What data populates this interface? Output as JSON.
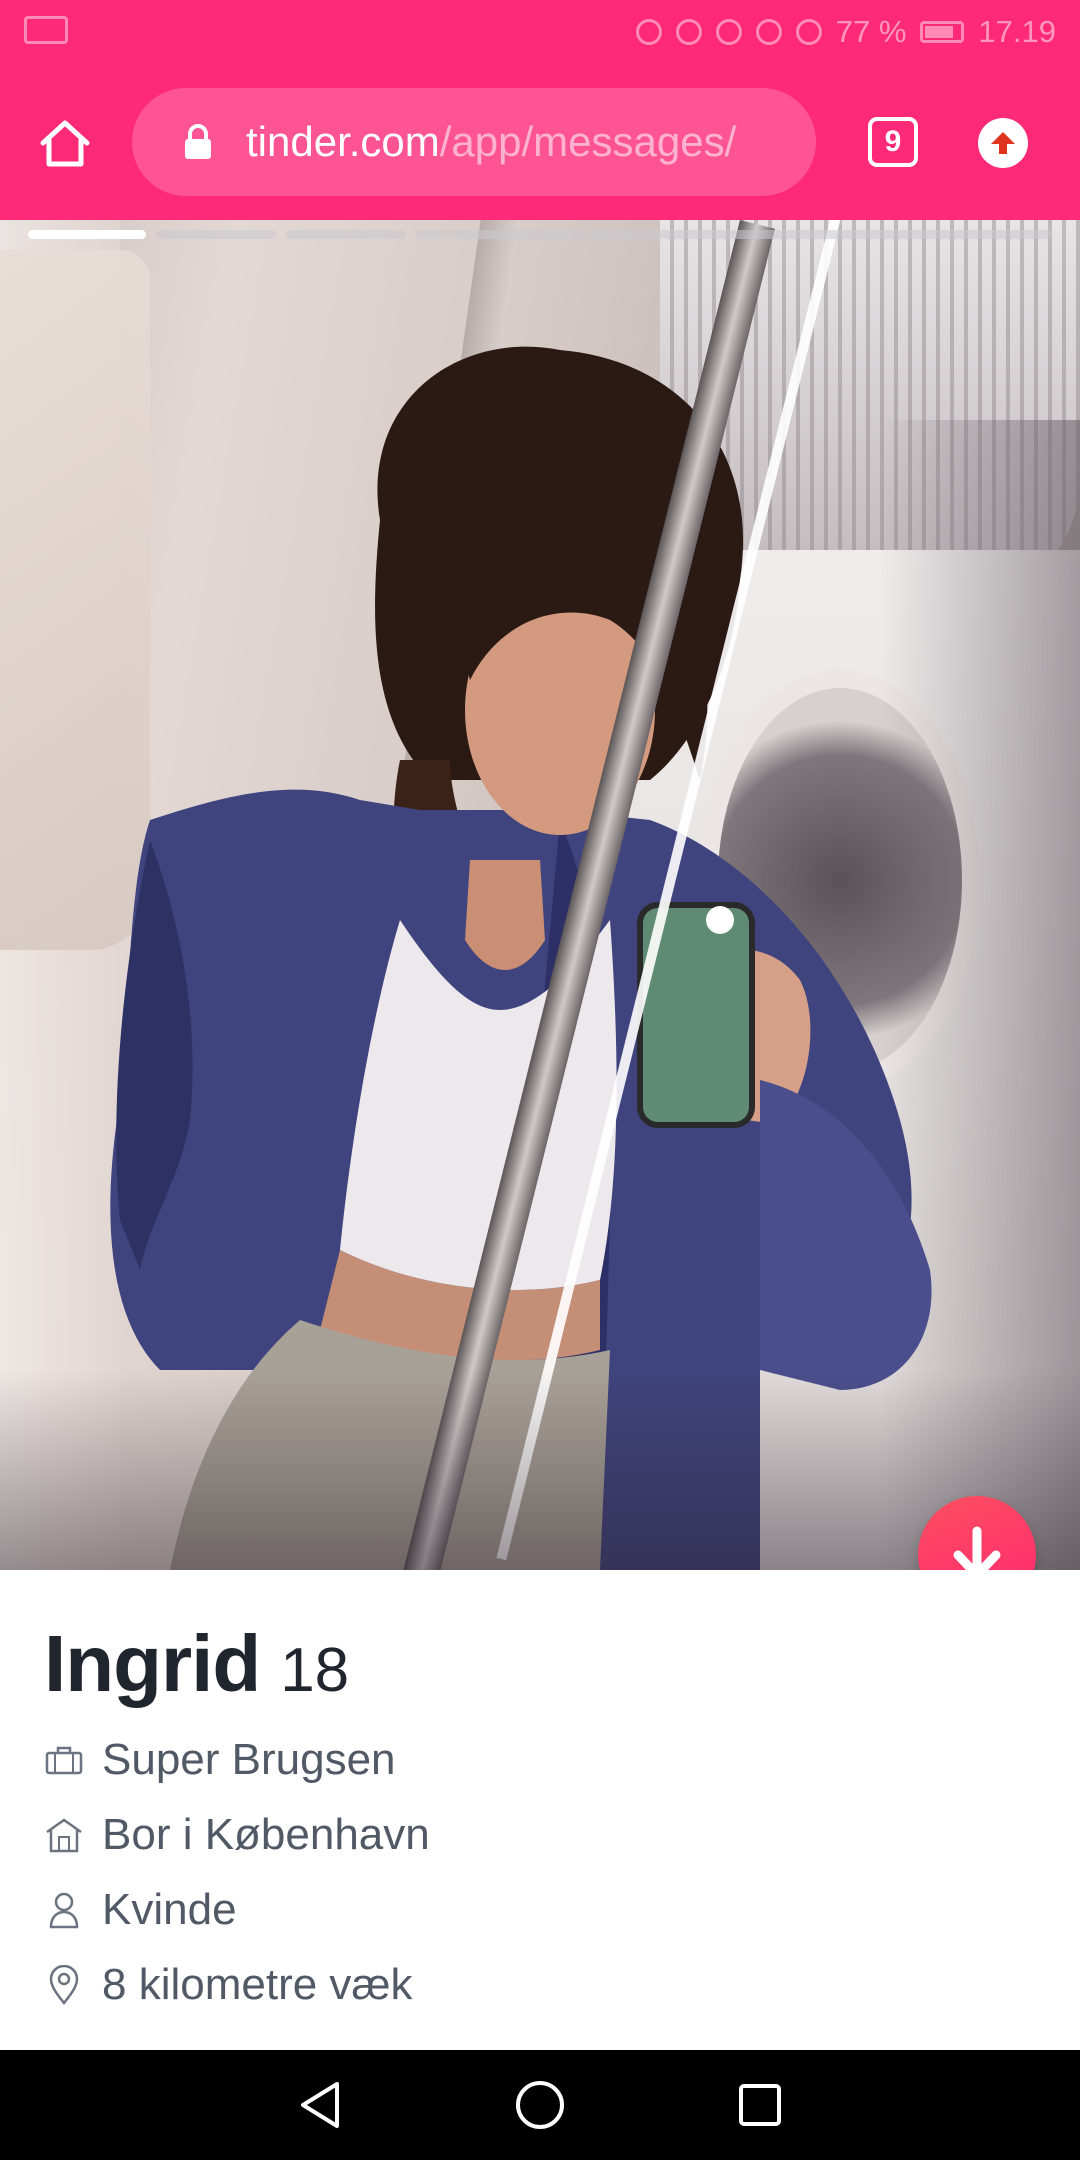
{
  "status_bar": {
    "battery": "77 %",
    "time": "17.19"
  },
  "browser": {
    "url_host": "tinder.com",
    "url_path": "/app/messages/",
    "tab_count": "9",
    "icons": {
      "home": "home-icon",
      "lock": "lock-icon",
      "update": "arrow-up-icon"
    }
  },
  "profile": {
    "photo_count": 4,
    "active_photo": 1,
    "name": "Ingrid",
    "age": "18",
    "details": [
      {
        "icon": "briefcase-icon",
        "text": "Super Brugsen"
      },
      {
        "icon": "house-icon",
        "text": "Bor i København"
      },
      {
        "icon": "person-icon",
        "text": "Kvinde"
      },
      {
        "icon": "location-pin-icon",
        "text": "8 kilometre væk"
      }
    ]
  },
  "colors": {
    "brand": "#fe2a78",
    "button_gradient_start": "#ff4f60",
    "button_gradient_end": "#fd2670",
    "name_text": "#21262e",
    "detail_text": "#505965"
  }
}
